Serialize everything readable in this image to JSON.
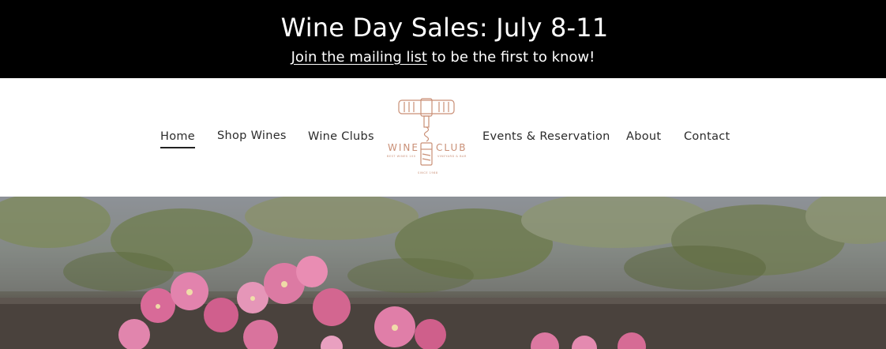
{
  "announcement": {
    "title": "Wine Day Sales: July 8-11",
    "link_text": "Join the mailing list",
    "suffix_text": " to be the first to know!"
  },
  "nav": {
    "items": [
      {
        "label": "Home",
        "active": true
      },
      {
        "label": "Shop Wines"
      },
      {
        "label": "Wine Clubs"
      },
      {
        "label": "Events & Reservation"
      },
      {
        "label": "About"
      },
      {
        "label": "Contact"
      }
    ]
  },
  "logo": {
    "left_word": "WINE",
    "right_word": "CLUB",
    "tagline_left": "BEST WINES 100",
    "tagline_right": "VINEYARD & BAR",
    "since": "SINCE 1988"
  },
  "hero": {
    "image": "pink-flowers-in-planter-photo"
  },
  "colors": {
    "announcement_bg": "#000000",
    "logo_accent": "#c98f76",
    "nav_text": "#2b2b2b"
  }
}
